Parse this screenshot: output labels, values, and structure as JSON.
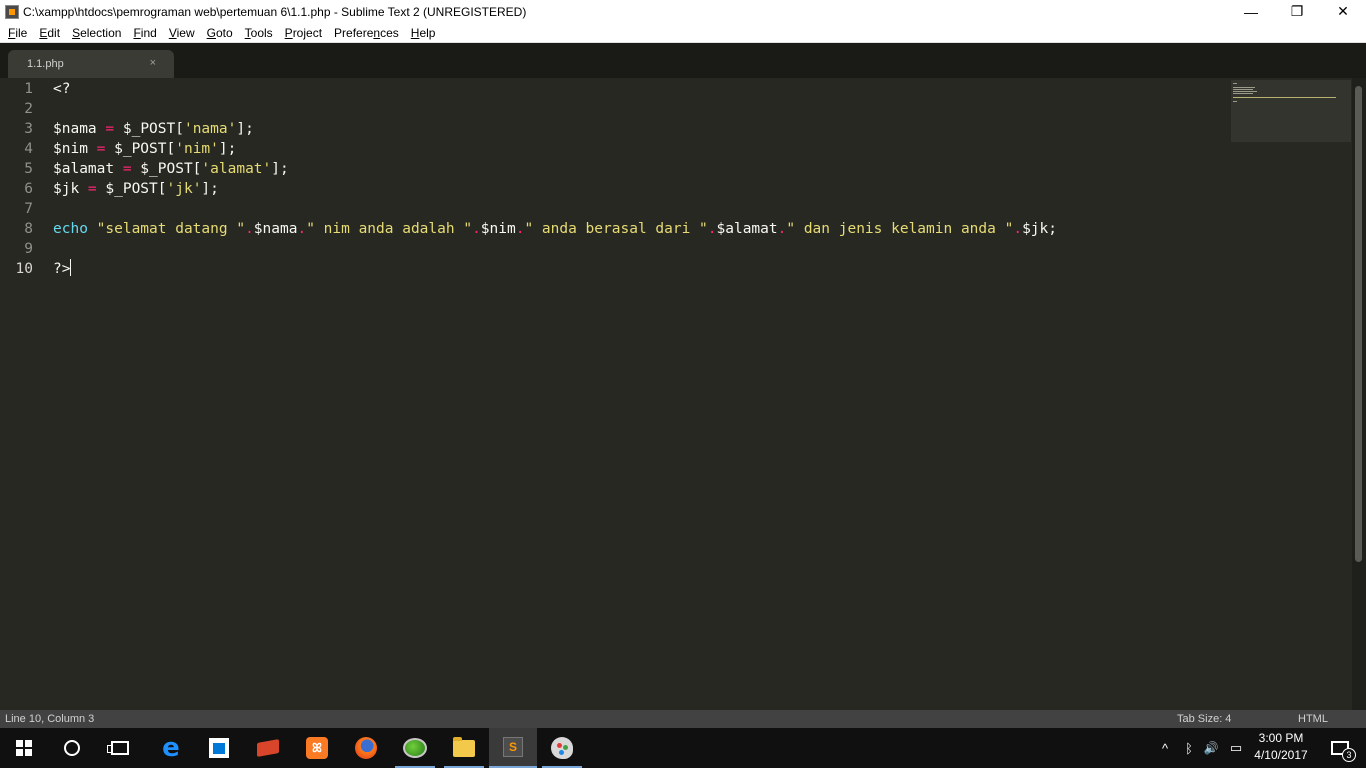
{
  "window": {
    "title": "C:\\xampp\\htdocs\\pemrograman web\\pertemuan 6\\1.1.php - Sublime Text 2 (UNREGISTERED)",
    "minimize_glyph": "—",
    "restore_glyph": "❐",
    "close_glyph": "✕"
  },
  "menu": {
    "file": {
      "u": "F",
      "rest": "ile"
    },
    "edit": {
      "u": "E",
      "rest": "dit"
    },
    "selection": {
      "u": "S",
      "rest": "election"
    },
    "find": {
      "u": "F",
      "rest": "ind",
      "pre": ""
    },
    "view": {
      "u": "V",
      "rest": "iew"
    },
    "goto": {
      "u": "G",
      "rest": "oto"
    },
    "tools": {
      "u": "T",
      "rest": "ools"
    },
    "project": {
      "u": "P",
      "rest": "roject"
    },
    "preferences": {
      "pre": "Prefere",
      "u": "n",
      "rest": "ces"
    },
    "help": {
      "u": "H",
      "rest": "elp"
    }
  },
  "tab": {
    "label": "1.1.php",
    "close": "×"
  },
  "editor": {
    "line_numbers": [
      "1",
      "2",
      "3",
      "4",
      "5",
      "6",
      "7",
      "8",
      "9",
      "10"
    ],
    "code": {
      "l1": "<?",
      "l3": {
        "var": "$nama ",
        "op": "=",
        "mid": " $_POST[",
        "str": "'nama'",
        "end": "];"
      },
      "l4": {
        "var": "$nim ",
        "op": "=",
        "mid": " $_POST[",
        "str": "'nim'",
        "end": "];"
      },
      "l5": {
        "var": "$alamat ",
        "op": "=",
        "mid": " $_POST[",
        "str": "'alamat'",
        "end": "];"
      },
      "l6": {
        "var": "$jk ",
        "op": "=",
        "mid": " $_POST[",
        "str": "'jk'",
        "end": "];"
      },
      "l8": {
        "kw": "echo",
        "s1": " \"selamat datang \"",
        "d1": ".",
        "v1": "$nama",
        "d2": ".",
        "s2": "\" nim anda adalah \"",
        "d3": ".",
        "v2": "$nim",
        "d4": ".",
        "s3": "\" anda berasal dari \"",
        "d5": ".",
        "v3": "$alamat",
        "d6": ".",
        "s4": "\" dan jenis kelamin anda \"",
        "d7": ".",
        "v4": "$jk;"
      },
      "l10": "?>"
    }
  },
  "status": {
    "position": "Line 10, Column 3",
    "tab_size": "Tab Size: 4",
    "syntax": "HTML"
  },
  "taskbar": {
    "sublime_letter": "S",
    "clock_time": "3:00 PM",
    "clock_date": "4/10/2017",
    "notification_count": "3",
    "tray_chevron": "^",
    "bluetooth_glyph": "ᛒ",
    "volume_glyph": "🔊",
    "network_glyph": "▭"
  },
  "colors": {
    "editor_bg": "#272822",
    "keyword": "#66d9ef",
    "string": "#e6db74",
    "operator": "#f92672",
    "text": "#f8f8f2"
  }
}
